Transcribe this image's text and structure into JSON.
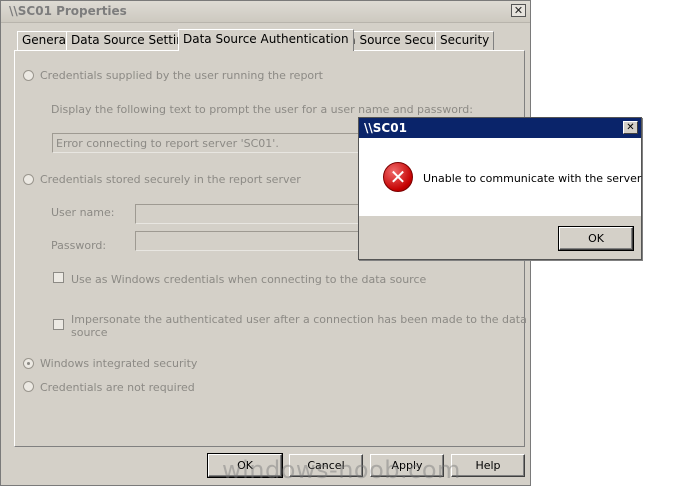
{
  "window": {
    "title": "\\\\SC01 Properties",
    "close_glyph": "✕"
  },
  "tabs": [
    {
      "label": "General",
      "active": false
    },
    {
      "label": "Data Source Settings",
      "active": false
    },
    {
      "label": "Data Source Authentication",
      "active": true
    },
    {
      "label": "Data Source Security",
      "active": false
    },
    {
      "label": "Security",
      "active": false
    }
  ],
  "auth": {
    "option_user_supplied": "Credentials supplied by the user running the report",
    "prompt_label": "Display the following text to prompt the user for a user name and password:",
    "prompt_value": "Error connecting to report server 'SC01'.",
    "option_stored": "Credentials stored securely in the report server",
    "username_label": "User name:",
    "password_label": "Password:",
    "use_windows_creds": "Use as Windows credentials when connecting to the data source",
    "impersonate_line1": "Impersonate the authenticated user after a connection has been made to the data",
    "impersonate_line2": "source",
    "option_windows_integrated": "Windows integrated security",
    "option_not_required": "Credentials are not required",
    "selected_option": "Windows integrated security"
  },
  "buttons": {
    "ok": "OK",
    "cancel": "Cancel",
    "apply": "Apply",
    "help": "Help"
  },
  "watermark": "windows-noob.com",
  "dialog": {
    "title": "\\\\SC01",
    "close_glyph": "✕",
    "icon": "error-icon",
    "icon_glyph": "✕",
    "message": "Unable to communicate with the server",
    "ok": "OK"
  }
}
